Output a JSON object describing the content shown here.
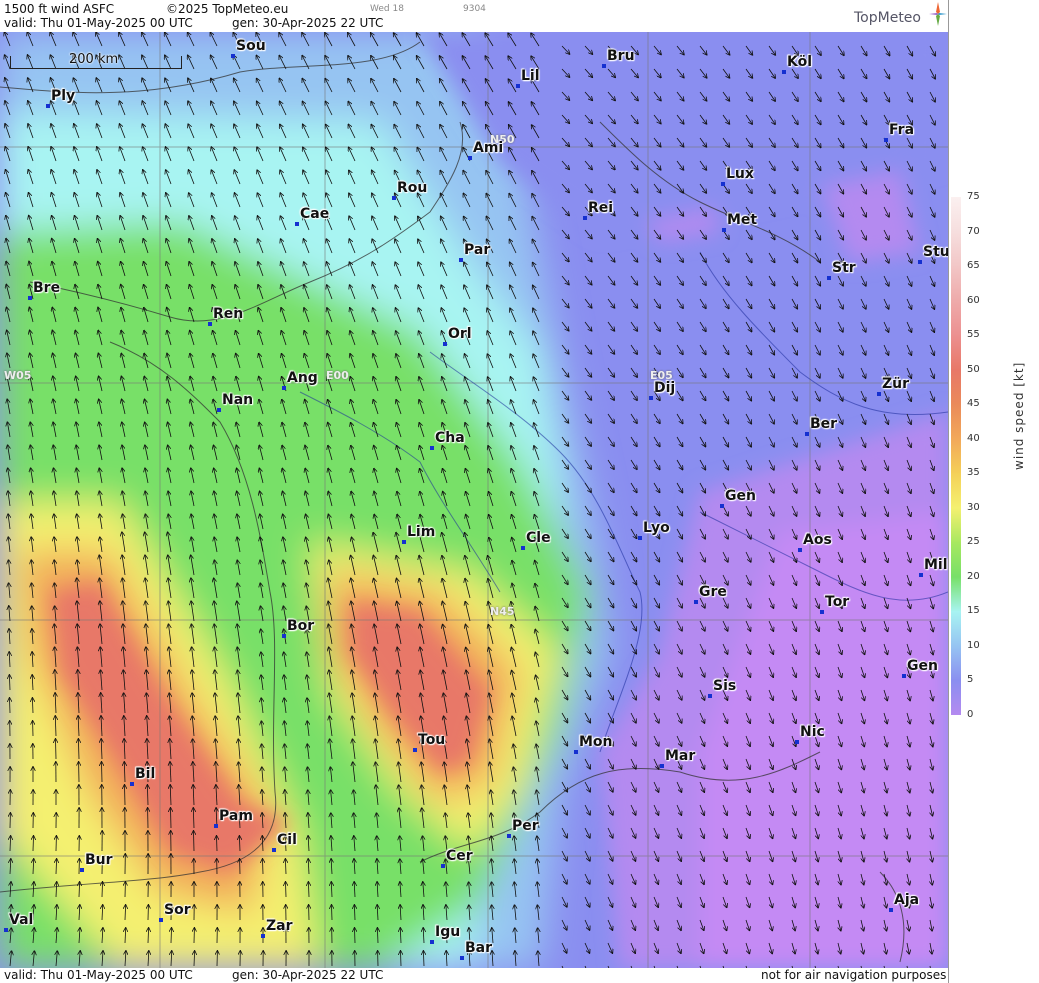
{
  "header": {
    "product": "1500 ft wind ASFC",
    "copyright": "©2025 TopMeteo.eu",
    "weekday_short": "Wed 18",
    "code": "9304",
    "valid": "valid:  Thu  01-May-2025  00 UTC",
    "gen": "gen: 30-Apr-2025 22 UTC",
    "brand": "TopMeteo"
  },
  "map": {
    "scale_label": "200 km",
    "grid_labels": [
      "N50",
      "N45",
      "W05",
      "E00",
      "E05"
    ],
    "cities": [
      {
        "name": "Sou"
      },
      {
        "name": "Lil"
      },
      {
        "name": "Bru"
      },
      {
        "name": "Köl"
      },
      {
        "name": "Ply"
      },
      {
        "name": "Ami"
      },
      {
        "name": "Fra"
      },
      {
        "name": "Lux"
      },
      {
        "name": "Rou"
      },
      {
        "name": "Cae"
      },
      {
        "name": "Rei"
      },
      {
        "name": "Met"
      },
      {
        "name": "Par"
      },
      {
        "name": "Stu"
      },
      {
        "name": "Bre"
      },
      {
        "name": "Str"
      },
      {
        "name": "Ren"
      },
      {
        "name": "Orl"
      },
      {
        "name": "Ang"
      },
      {
        "name": "Dij"
      },
      {
        "name": "Zür"
      },
      {
        "name": "Nan"
      },
      {
        "name": "Ber"
      },
      {
        "name": "Cha"
      },
      {
        "name": "Gen"
      },
      {
        "name": "Lim"
      },
      {
        "name": "Cle"
      },
      {
        "name": "Lyo"
      },
      {
        "name": "Aos"
      },
      {
        "name": "Mil"
      },
      {
        "name": "Gre"
      },
      {
        "name": "Tor"
      },
      {
        "name": "Bor"
      },
      {
        "name": "Gen"
      },
      {
        "name": "Sis"
      },
      {
        "name": "Tou"
      },
      {
        "name": "Mon"
      },
      {
        "name": "Nic"
      },
      {
        "name": "Mar"
      },
      {
        "name": "Bil"
      },
      {
        "name": "Pam"
      },
      {
        "name": "Cil"
      },
      {
        "name": "Per"
      },
      {
        "name": "Bur"
      },
      {
        "name": "Cer"
      },
      {
        "name": "Sor"
      },
      {
        "name": "Aja"
      },
      {
        "name": "Val"
      },
      {
        "name": "Zar"
      },
      {
        "name": "Igu"
      },
      {
        "name": "Bar"
      }
    ]
  },
  "legend": {
    "title": "wind speed [kt]",
    "ticks": [
      "75",
      "70",
      "65",
      "60",
      "55",
      "50",
      "45",
      "40",
      "35",
      "30",
      "25",
      "20",
      "15",
      "10",
      "5",
      "0"
    ],
    "colors": [
      "#fbf0f0",
      "#f6dede",
      "#f2c6c6",
      "#eeaaaa",
      "#ec9090",
      "#e87868",
      "#ea8a5a",
      "#f2a85a",
      "#f4d058",
      "#f4f070",
      "#a8e860",
      "#78e068",
      "#a8f4f2",
      "#96c4f2",
      "#8a8ef0",
      "#b48af0"
    ]
  },
  "footer": {
    "valid": "valid:  Thu  01-May-2025  00 UTC",
    "gen": "gen: 30-Apr-2025 22 UTC",
    "disclaimer": "not for air navigation purposes"
  }
}
